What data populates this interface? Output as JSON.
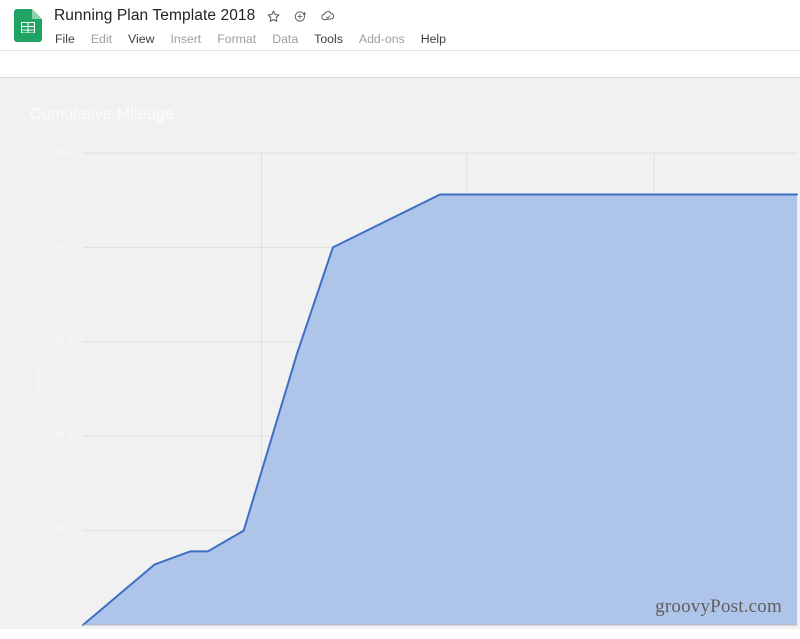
{
  "app": {
    "logo_icon": "google-sheets-icon",
    "document_title": "Running Plan Template 2018"
  },
  "title_actions": [
    {
      "icon": "star-icon",
      "label": "Star"
    },
    {
      "icon": "add-to-drive-icon",
      "label": "Move to Drive"
    },
    {
      "icon": "cloud-offline-icon",
      "label": "See document status"
    }
  ],
  "menubar": {
    "items": [
      {
        "label": "File",
        "dim": false
      },
      {
        "label": "Edit",
        "dim": true
      },
      {
        "label": "View",
        "dim": false
      },
      {
        "label": "Insert",
        "dim": true
      },
      {
        "label": "Format",
        "dim": true
      },
      {
        "label": "Data",
        "dim": true
      },
      {
        "label": "Tools",
        "dim": false
      },
      {
        "label": "Add-ons",
        "dim": true
      },
      {
        "label": "Help",
        "dim": false
      }
    ]
  },
  "watermark": {
    "text": "groovyPost.com"
  },
  "colors": {
    "line": "#3d6fc4",
    "fill": "#aec4e8",
    "plot_background": "#f1f1f1",
    "gridline": "#e0e0e0",
    "axis_text": "#fafafa",
    "brand_green": "#1fa463"
  },
  "chart_data": {
    "type": "area",
    "title": "Cumulative Mileage",
    "xlabel": "",
    "ylabel": "Mileage (mi)",
    "ylim": [
      0,
      125
    ],
    "yticks": [
      0,
      25,
      50,
      75,
      100,
      125
    ],
    "ytick_labels": [
      "0.0",
      "25.0",
      "50.0",
      "75.0",
      "100.0",
      "125.0"
    ],
    "grid": true,
    "legend": "none",
    "xlim": [
      0,
      40
    ],
    "x": [
      0,
      4,
      6,
      7,
      9,
      12,
      14,
      20,
      40
    ],
    "values": [
      0,
      16,
      19.5,
      19.5,
      25,
      72,
      100,
      114,
      114
    ],
    "series": [
      {
        "name": "Cumulative Mileage",
        "values": [
          0,
          16,
          19.5,
          19.5,
          25,
          72,
          100,
          114,
          114
        ]
      }
    ],
    "vertical_gridlines_x": [
      10,
      21.5,
      32
    ],
    "fill_opacity": 1
  }
}
